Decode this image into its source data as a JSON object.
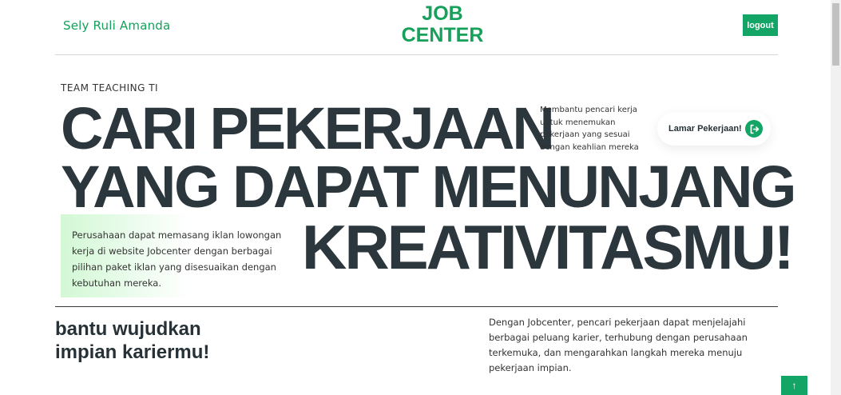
{
  "header": {
    "user_name": "Sely Ruli Amanda",
    "logo_line1": "JOB",
    "logo_line2": "CENTER",
    "logout_label": "logout"
  },
  "hero": {
    "eyebrow": "TEAM TEACHING TI",
    "headline_line1": "CARI PEKERJAAN",
    "headline_line2": "YANG DAPAT MENUNJANG",
    "headline_line3": "KREATIVITASMU!",
    "side_description": "Membantu pencari kerja untuk menemukan pekerjaan yang sesuai dengan keahlian mereka",
    "cta_label": "Lamar Pekerjaan!",
    "company_text": "Perusahaan dapat memasang iklan lowongan kerja di website Jobcenter dengan berbagai pilihan paket iklan yang disesuaikan dengan kebutuhan mereka."
  },
  "about": {
    "tagline": "bantu wujudkan impian kariermu!",
    "description": "Dengan Jobcenter, pencari pekerjaan dapat menjelajahi berbagai peluang karier, terhubung dengan perusahaan terkemuka, dan mengarahkan langkah mereka menuju pekerjaan impian."
  },
  "colors": {
    "accent": "#13a565",
    "brand_text": "#16a05a",
    "headline": "#2b363d",
    "card_gradient_start": "#d3f8d5"
  },
  "icons": {
    "cta": "arrow-right-from-bracket-icon",
    "scroll_top": "arrow-up-icon"
  }
}
